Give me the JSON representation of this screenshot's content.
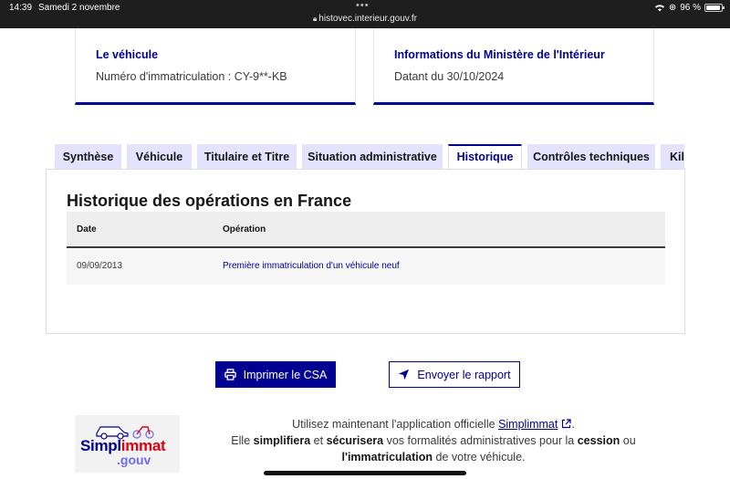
{
  "status_bar": {
    "time": "14:39",
    "date": "Samedi 2 novembre",
    "url": "histovec.interieur.gouv.fr",
    "battery": "96 %",
    "battery_level": 0.96
  },
  "cards": [
    {
      "title": "Le véhicule",
      "text": "Numéro d'immatriculation : CY-9**-KB"
    },
    {
      "title": "Informations du Ministère de l'Intérieur",
      "text": "Datant du 30/10/2024"
    }
  ],
  "tabs": [
    {
      "label": "Synthèse"
    },
    {
      "label": "Véhicule"
    },
    {
      "label": "Titulaire et Titre"
    },
    {
      "label": "Situation administrative"
    },
    {
      "label": "Historique"
    },
    {
      "label": "Contrôles techniques"
    },
    {
      "label": "Kilo"
    }
  ],
  "active_tab": "Historique",
  "history": {
    "title": "Historique des opérations en France",
    "columns": [
      "Date",
      "Opération"
    ],
    "rows": [
      {
        "date": "09/09/2013",
        "operation": "Première immatriculation d'un véhicule neuf"
      }
    ]
  },
  "actions": {
    "print_label": "Imprimer le CSA",
    "send_label": "Envoyer le rapport"
  },
  "promo": {
    "logo_word_1": "Simpl",
    "logo_word_2": "immat",
    "logo_domain": ".gouv",
    "line1_before": "Utilisez maintenant l'application officielle",
    "link": "Simplimmat",
    "line1_after": ".",
    "line2_a": "Elle",
    "simplify": "simplifiera",
    "and": "et",
    "secure": "sécurisera",
    "line2_b": "vos formalités administratives pour la",
    "transfer": "cession",
    "or": "ou",
    "registration": "l'immatriculation",
    "line3_end": "de votre véhicule."
  },
  "colors": {
    "brand_blue": "#000091",
    "tab_bg": "#e3e3fd",
    "marianne_red": "#e1000f"
  }
}
